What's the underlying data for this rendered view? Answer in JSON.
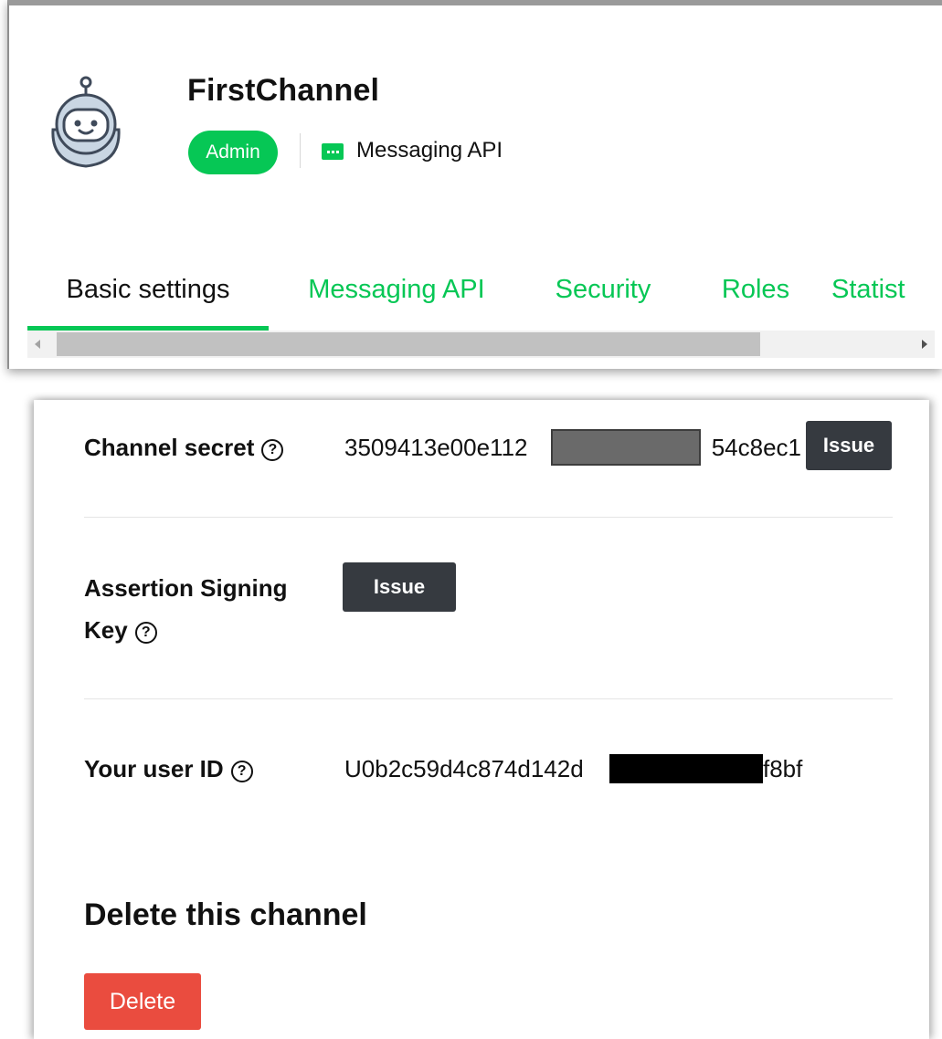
{
  "header": {
    "channel_name": "FirstChannel",
    "role_badge": "Admin",
    "channel_type_icon": "chat-bubble-icon",
    "channel_type": "Messaging API",
    "avatar_icon": "robot-avatar-icon"
  },
  "tabs": [
    {
      "label": "Basic settings",
      "active": true
    },
    {
      "label": "Messaging API",
      "active": false
    },
    {
      "label": "Security",
      "active": false
    },
    {
      "label": "Roles",
      "active": false
    },
    {
      "label": "Statist",
      "active": false
    }
  ],
  "settings": {
    "channel_secret": {
      "label": "Channel secret",
      "value_prefix": "3509413e00e112",
      "value_suffix": "54c8ec1",
      "button": "Issue",
      "help_icon": "question-circle-icon"
    },
    "assertion_key": {
      "label_line1": "Assertion Signing",
      "label_line2": "Key",
      "button": "Issue",
      "help_icon": "question-circle-icon"
    },
    "user_id": {
      "label": "Your user ID",
      "value_prefix": "U0b2c59d4c874d142d",
      "value_suffix": "f8bf",
      "help_icon": "question-circle-icon"
    }
  },
  "delete_section": {
    "title": "Delete this channel",
    "button": "Delete"
  },
  "colors": {
    "brand_green": "#06c755",
    "dark_button": "#363a40",
    "danger": "#ea4c3f"
  }
}
